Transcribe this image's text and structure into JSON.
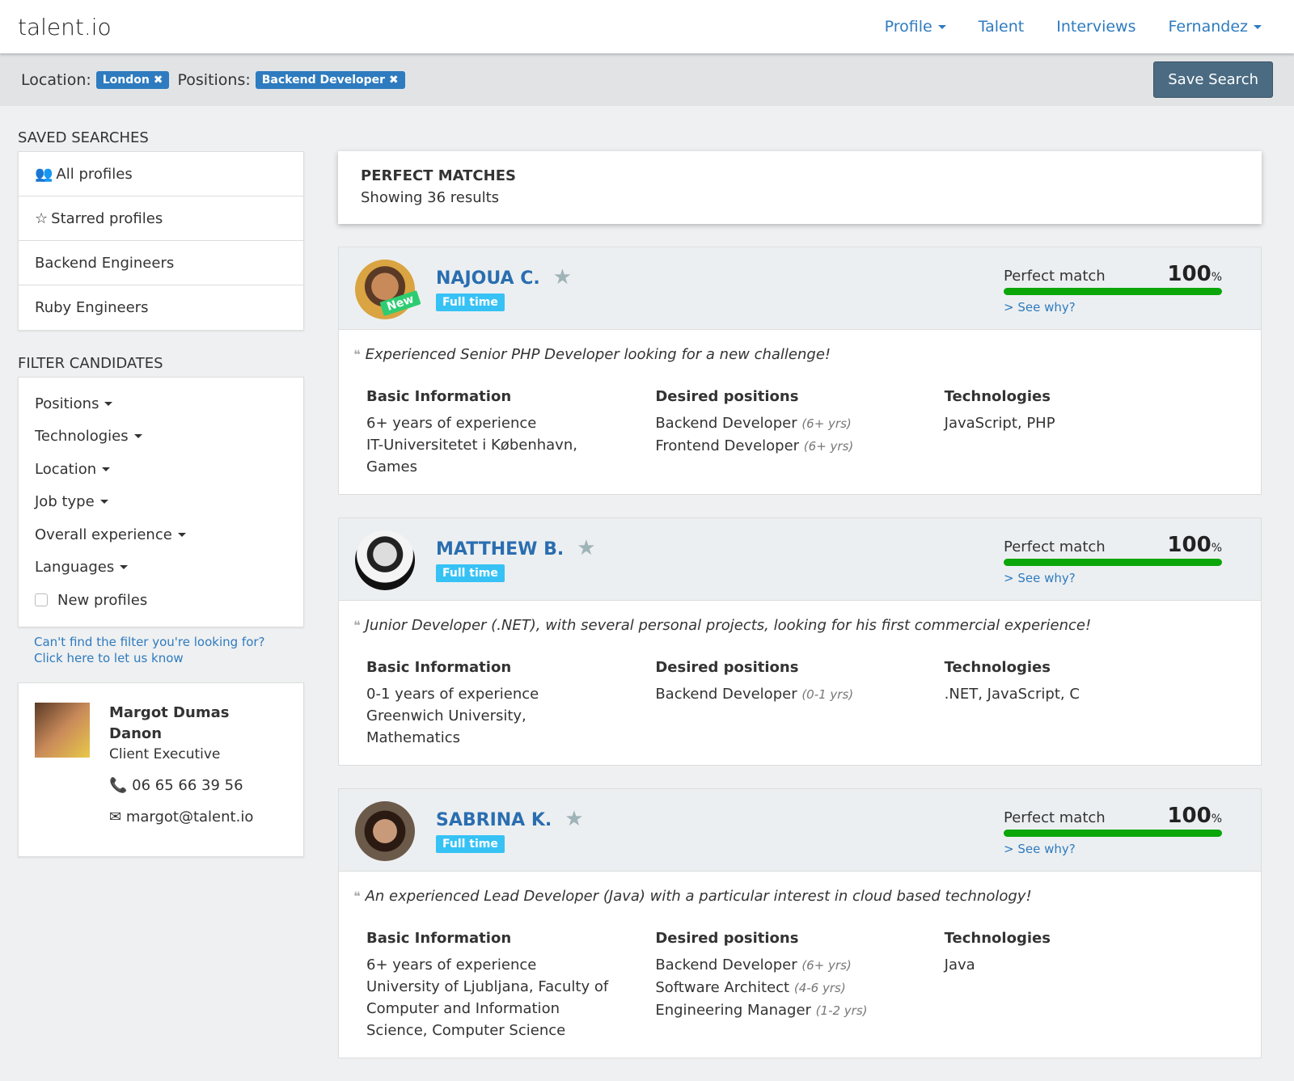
{
  "header": {
    "brand": "talent.io",
    "nav": [
      "Profile",
      "Talent",
      "Interviews",
      "Fernandez"
    ]
  },
  "filters": {
    "location_label": "Location:",
    "location_tag": "London ✖",
    "positions_label": "Positions:",
    "positions_tag": "Backend Developer ✖",
    "save": "Save Search"
  },
  "saved": {
    "title": "SAVED SEARCHES",
    "items": [
      "All profiles",
      "Starred profiles",
      "Backend Engineers",
      "Ruby Engineers"
    ]
  },
  "filter": {
    "title": "FILTER CANDIDATES",
    "items": [
      "Positions",
      "Technologies",
      "Location",
      "Job type",
      "Overall experience",
      "Languages"
    ],
    "checkbox": "New profiles",
    "help1": "Can't find the filter you're looking for?",
    "help2": "Click here to let us know"
  },
  "contact": {
    "name": "Margot Dumas Danon",
    "role": "Client Executive",
    "phone": "06 65 66 39 56",
    "email": "margot@talent.io"
  },
  "results": {
    "title": "PERFECT MATCHES",
    "count": "Showing 36 results"
  },
  "labels": {
    "match": "Perfect match",
    "why": "> See why?",
    "basic": "Basic Information",
    "desired": "Desired positions",
    "tech": "Technologies",
    "new": "New",
    "pct_sign": "%"
  },
  "candidates": [
    {
      "name": "NAJOUA C.",
      "type": "Full time",
      "match": 100,
      "match_text": "100",
      "quote": "Experienced Senior PHP Developer looking for a new challenge!",
      "basic": [
        "6+ years of experience",
        "IT-Universitetet i København, Games"
      ],
      "positions": [
        [
          "Backend Developer",
          "(6+ yrs)"
        ],
        [
          "Frontend Developer",
          "(6+ yrs)"
        ]
      ],
      "tech": "JavaScript, PHP"
    },
    {
      "name": "MATTHEW B.",
      "type": "Full time",
      "match": 100,
      "match_text": "100",
      "quote": "Junior Developer (.NET), with several personal projects, looking for his first commercial experience!",
      "basic": [
        "0-1 years of experience",
        "Greenwich University, Mathematics"
      ],
      "positions": [
        [
          "Backend Developer",
          "(0-1 yrs)"
        ]
      ],
      "tech": ".NET, JavaScript, C"
    },
    {
      "name": "SABRINA K.",
      "type": "Full time",
      "match": 100,
      "match_text": "100",
      "quote": "An experienced Lead Developer (Java) with a particular interest in cloud based technology!",
      "basic": [
        "6+ years of experience",
        "University of Ljubljana, Faculty of Computer and Information Science, Computer Science"
      ],
      "positions": [
        [
          "Backend Developer",
          "(6+ yrs)"
        ],
        [
          "Software Architect",
          "(4-6 yrs)"
        ],
        [
          "Engineering Manager",
          "(1-2 yrs)"
        ]
      ],
      "tech": "Java"
    }
  ]
}
